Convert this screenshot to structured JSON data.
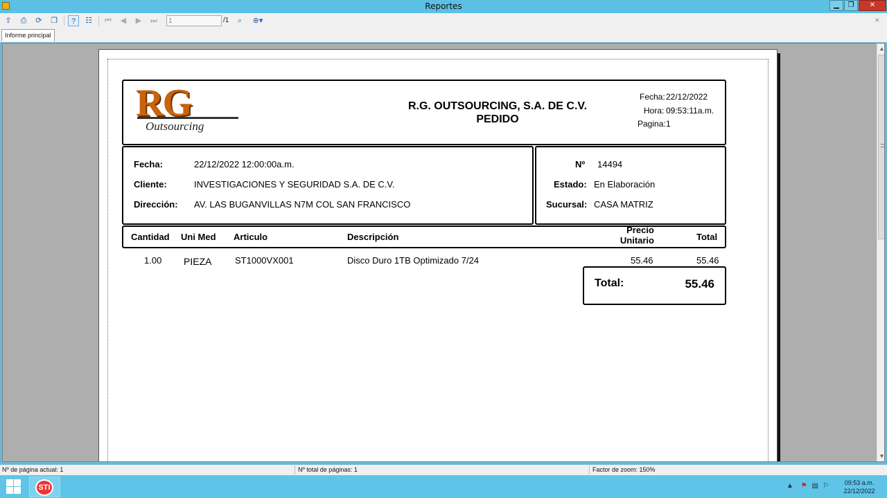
{
  "window": {
    "title": "Reportes",
    "minimize": "▁",
    "maximize": "❐",
    "close": "✕"
  },
  "toolbar": {
    "page_input": "1",
    "page_total": "/1",
    "close_doc": "✕"
  },
  "tabs": [
    {
      "label": "Informe principal"
    }
  ],
  "report": {
    "logo": {
      "main": "RG",
      "sub": "Outsourcing"
    },
    "company": "R.G. OUTSOURCING, S.A. DE C.V.",
    "doc_type": "PEDIDO",
    "header_meta": {
      "fecha_label": "Fecha:",
      "fecha": "22/12/2022",
      "hora_label": "Hora:",
      "hora": "09:53:11a.m.",
      "pagina_label": "Pagina:",
      "pagina": "1"
    },
    "info": {
      "fecha_label": "Fecha:",
      "fecha": "22/12/2022  12:00:00a.m.",
      "cliente_label": "Cliente:",
      "cliente": "INVESTIGACIONES Y SEGURIDAD S.A. DE C.V.",
      "direccion_label": "Dirección:",
      "direccion": "AV. LAS BUGANVILLAS N7M COL SAN FRANCISCO"
    },
    "state": {
      "no_label": "Nº",
      "no": "14494",
      "estado_label": "Estado:",
      "estado": "En Elaboración",
      "sucursal_label": "Sucursal:",
      "sucursal": "CASA MATRIZ"
    },
    "columns": {
      "cantidad": "Cantidad",
      "unimed": "Uni Med",
      "articulo": "Articulo",
      "descripcion": "Descripción",
      "precio_1": "Precio",
      "precio_2": "Unitario",
      "total": "Total"
    },
    "rows": [
      {
        "cantidad": "1.00",
        "unimed": "PIEZA",
        "articulo": "ST1000VX001",
        "descripcion": "Disco Duro 1TB Optimizado 7/24",
        "precio": "55.46",
        "total": "55.46"
      }
    ],
    "grand_total_label": "Total:",
    "grand_total": "55.46"
  },
  "statusbar": {
    "current_page": "Nº de página actual: 1",
    "total_pages": "Nº total de páginas: 1",
    "zoom": "Factor de zoom: 150%"
  },
  "taskbar": {
    "app_icon": "STI",
    "clock_time": "09:53 a.m.",
    "clock_date": "22/12/2022"
  }
}
